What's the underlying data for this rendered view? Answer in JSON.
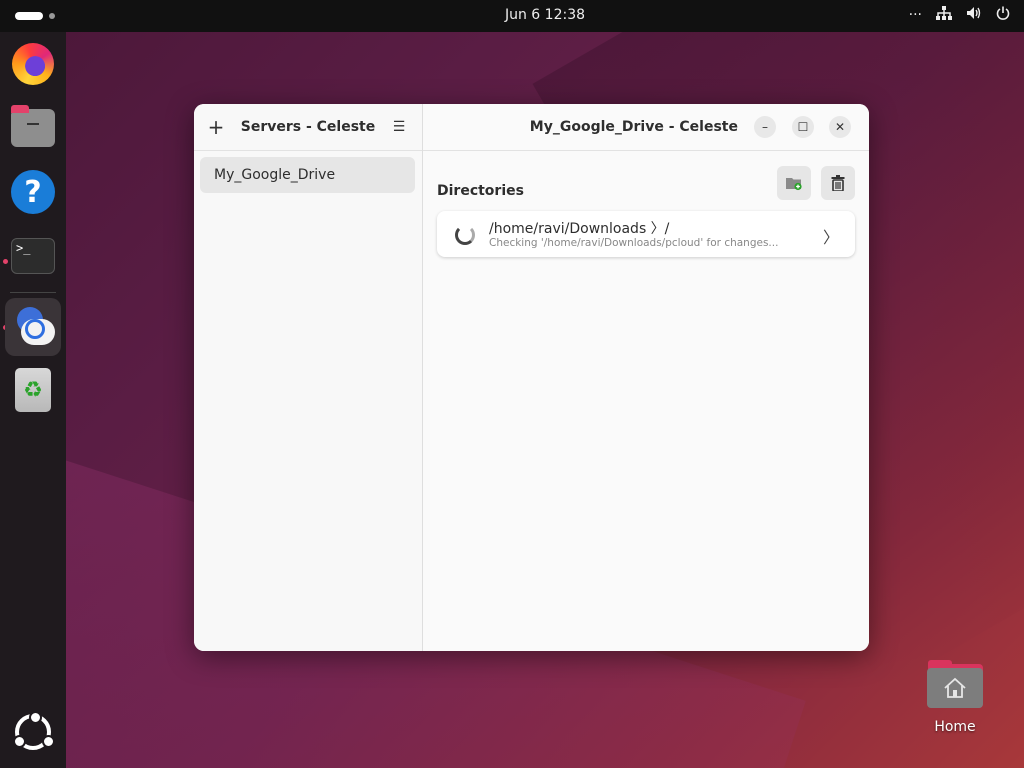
{
  "topbar": {
    "clock": "Jun 6  12:38",
    "overflow_label": "···"
  },
  "dock": {
    "items": [
      {
        "name": "firefox-icon"
      },
      {
        "name": "files-icon"
      },
      {
        "name": "help-icon",
        "glyph": "?"
      },
      {
        "name": "terminal-icon",
        "glyph": ">_"
      },
      {
        "name": "celeste-icon"
      },
      {
        "name": "trash-icon",
        "glyph": "♻"
      },
      {
        "name": "show-apps-icon"
      }
    ]
  },
  "sidebar": {
    "add_glyph": "+",
    "title": "Servers - Celeste",
    "menu_glyph": "☰",
    "servers": [
      {
        "label": "My_Google_Drive"
      }
    ]
  },
  "main": {
    "title": "My_Google_Drive - Celeste",
    "section_label": "Directories",
    "directories": [
      {
        "path": "/home/ravi/Downloads 〉/",
        "status": "Checking '/home/ravi/Downloads/pcloud' for changes..."
      }
    ],
    "chevron": "〉"
  },
  "window_controls": {
    "minimize_glyph": "–",
    "maximize_glyph": "☐",
    "close_glyph": "✕"
  },
  "desktop": {
    "home_label": "Home"
  },
  "colors": {
    "accent": "#e3426a",
    "folder": "#d9345d"
  }
}
